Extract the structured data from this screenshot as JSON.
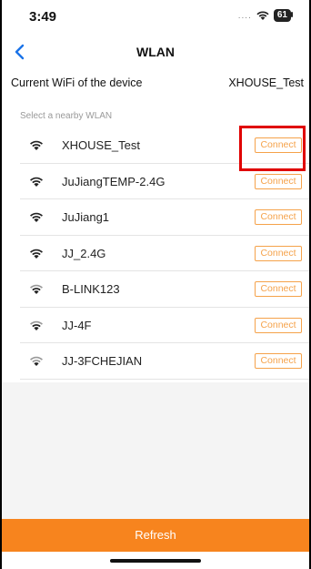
{
  "status": {
    "time": "3:49",
    "signal": "....",
    "battery": "61"
  },
  "nav": {
    "title": "WLAN"
  },
  "current": {
    "label": "Current WiFi of the device",
    "value": "XHOUSE_Test"
  },
  "section_label": "Select a nearby WLAN",
  "networks": [
    {
      "name": "XHOUSE_Test",
      "action": "Connect"
    },
    {
      "name": "JuJiangTEMP-2.4G",
      "action": "Connect"
    },
    {
      "name": "JuJiang1",
      "action": "Connect"
    },
    {
      "name": "JJ_2.4G",
      "action": "Connect"
    },
    {
      "name": "B-LINK123",
      "action": "Connect"
    },
    {
      "name": "JJ-4F",
      "action": "Connect"
    },
    {
      "name": "JJ-3FCHEJIAN",
      "action": "Connect"
    }
  ],
  "refresh_label": "Refresh",
  "colors": {
    "accent": "#f7841e",
    "connect_border": "#f5a24a",
    "highlight": "#e00000",
    "back_arrow": "#1a73e8"
  }
}
